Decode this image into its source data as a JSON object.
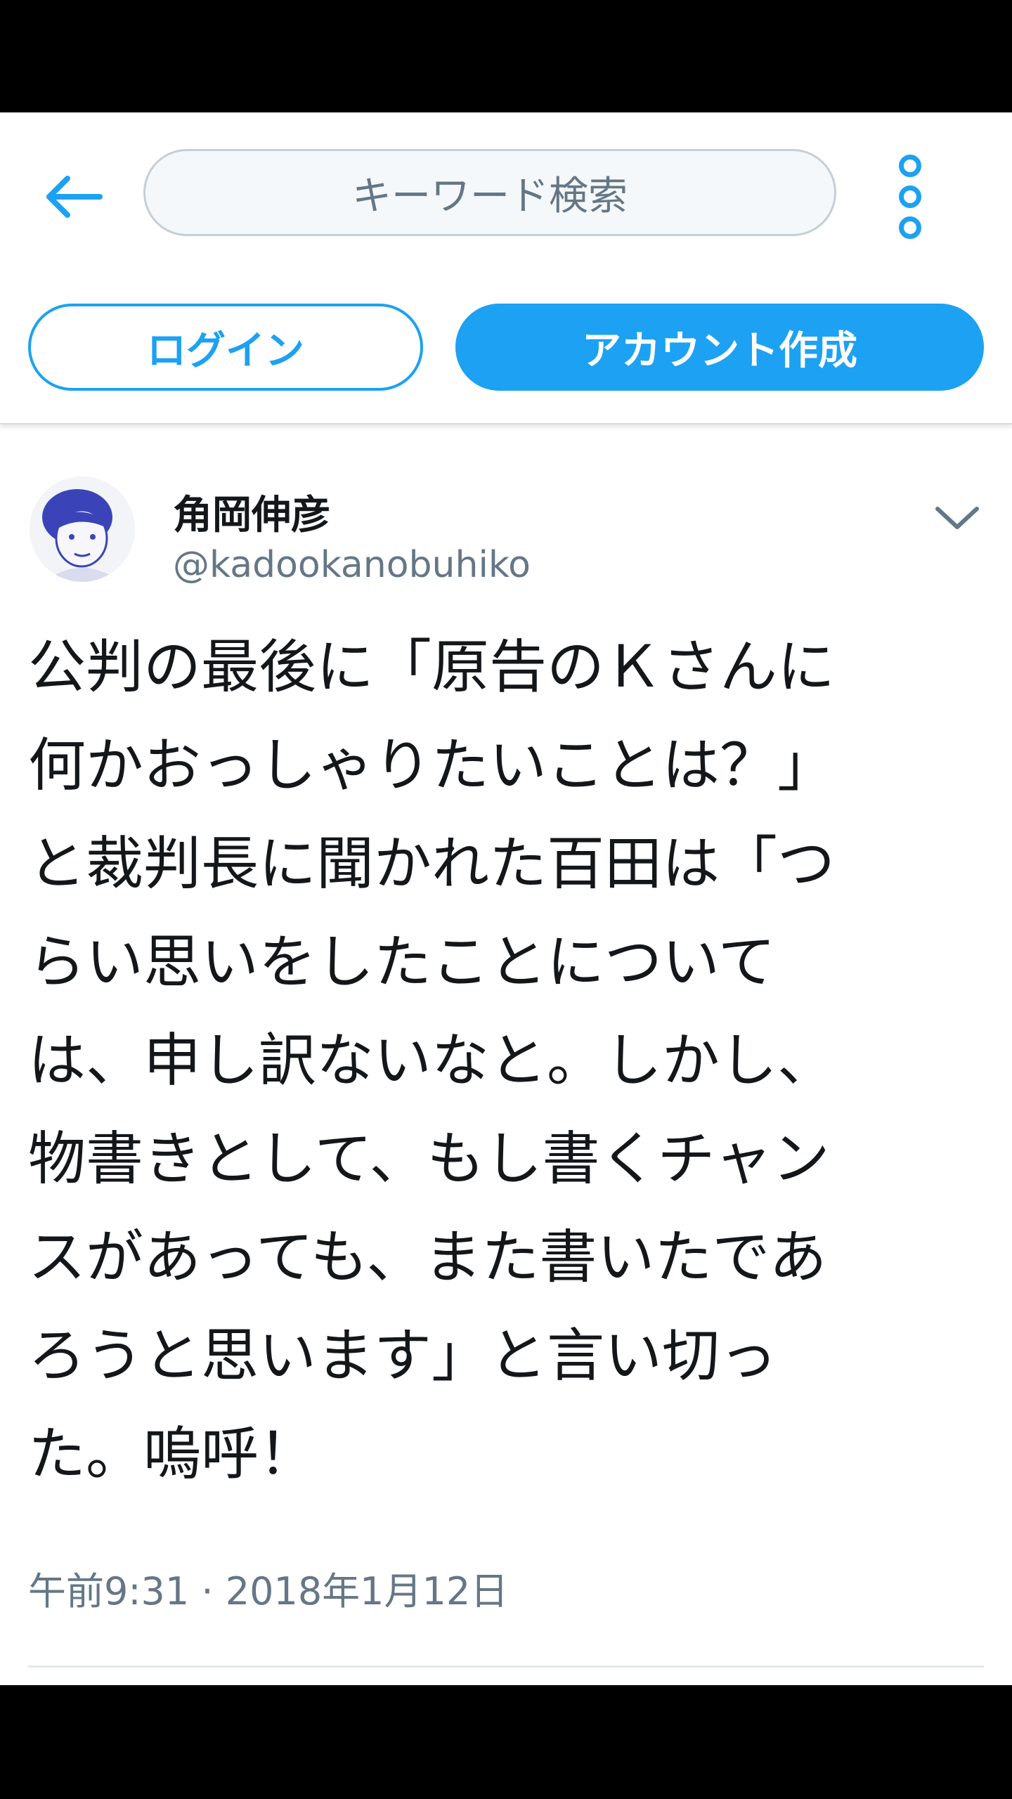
{
  "header": {
    "search_placeholder": "キーワード検索",
    "login_label": "ログイン",
    "signup_label": "アカウント作成",
    "icons": [
      "back-arrow-icon",
      "more-vertical-icon"
    ]
  },
  "tweet": {
    "display_name": "角岡伸彦",
    "handle": "@kadookanobuhiko",
    "text": "公判の最後に「原告のＫさんに\n何かおっしゃりたいことは？」\nと裁判長に聞かれた百田は「つ\nらい思いをしたことについて\nは、申し訳ないなと。しかし、\n物書きとして、もし書くチャン\nスがあっても、また書いたであ\nろうと思います」と言い切っ\nた。嗚呼！",
    "timestamp": "午前9:31 · 2018年1月12日",
    "icons": [
      "avatar-image",
      "chevron-down-icon"
    ]
  },
  "colors": {
    "accent": "#1da1f2",
    "text_primary": "#14171a",
    "text_secondary": "#657786",
    "search_bg": "#f5f8fa",
    "search_border": "#c4cfd6"
  }
}
